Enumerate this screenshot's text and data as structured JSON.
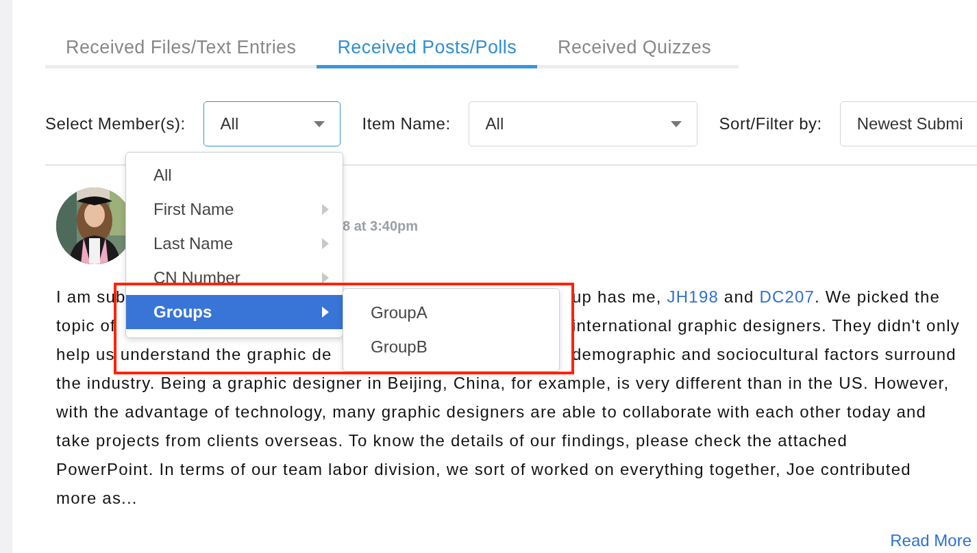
{
  "tabs": [
    {
      "label": "Received Files/Text Entries",
      "selected": false
    },
    {
      "label": "Received Posts/Polls",
      "selected": true
    },
    {
      "label": "Received Quizzes",
      "selected": false
    }
  ],
  "filters": [
    {
      "label": "Select Member(s):",
      "value": "All",
      "open": true
    },
    {
      "label": "Item Name:",
      "value": "All",
      "open": false
    },
    {
      "label": "Sort/Filter by:",
      "value": "Newest Submi",
      "open": false
    }
  ],
  "post": {
    "date": "8 at 3:40pm",
    "lines": [
      {
        "left": [
          {
            "text": "I am sub",
            "link": false
          }
        ],
        "right": [
          {
            "text": "up has me, ",
            "link": false
          },
          {
            "text": "JH198",
            "link": true
          },
          {
            "text": " and ",
            "link": false
          },
          {
            "text": "DC207",
            "link": true
          },
          {
            "text": ". We picked the",
            "link": false
          }
        ]
      },
      {
        "left": [
          {
            "text": "topic of",
            "link": false
          }
        ],
        "right": [
          {
            "text": "international graphic designers. They didn't only",
            "link": false
          }
        ]
      },
      {
        "left": [
          {
            "text": "help us understand the graphic de",
            "link": false
          }
        ],
        "right": [
          {
            "text": "demographic and sociocultural factors surround",
            "link": false
          }
        ]
      },
      {
        "left": [
          {
            "text": "the industry. Being a graphic designer in Beijing, China, for example, is very different than in the US. However,",
            "link": false
          }
        ]
      },
      {
        "left": [
          {
            "text": "with the advantage of technology, many graphic designers are able to collaborate with each other today and",
            "link": false
          }
        ]
      },
      {
        "left": [
          {
            "text": "take projects from clients overseas. To know the details of our findings, please check the attached",
            "link": false
          }
        ]
      },
      {
        "left": [
          {
            "text": "PowerPoint. In terms of our team labor division, we sort of worked on everything together, Joe contributed",
            "link": false
          }
        ]
      },
      {
        "left": [
          {
            "text": "more as...",
            "link": false
          }
        ]
      }
    ],
    "read_more": "Read More"
  },
  "menu": {
    "items": [
      {
        "label": "All",
        "has_submenu": false,
        "selected": false
      },
      {
        "label": "First Name",
        "has_submenu": true,
        "selected": false
      },
      {
        "label": "Last Name",
        "has_submenu": true,
        "selected": false
      },
      {
        "label": "CN Number",
        "has_submenu": true,
        "selected": false
      },
      {
        "label": "Groups",
        "has_submenu": true,
        "selected": true
      }
    ],
    "submenu": [
      {
        "label": "GroupA"
      },
      {
        "label": "GroupB"
      }
    ]
  },
  "highlight": {
    "shown": true
  }
}
